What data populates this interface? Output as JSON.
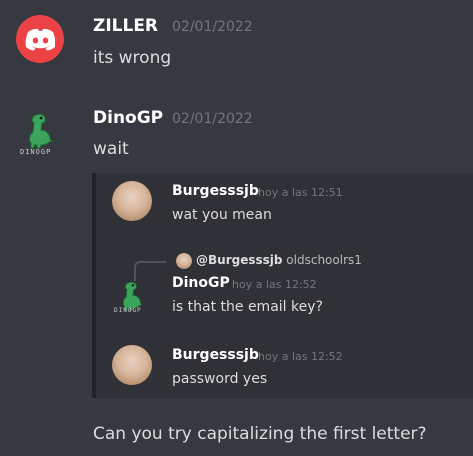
{
  "messages": [
    {
      "author": "ZILLER",
      "timestamp": "02/01/2022",
      "text": "its wrong",
      "avatar_icon": "discord-logo-icon",
      "avatar_color": "#ed4245"
    },
    {
      "author": "DinoGP",
      "timestamp": "02/01/2022",
      "text": "wait",
      "avatar_icon": "dino-avatar-icon",
      "avatar_caption": "DINOGP"
    },
    {
      "author": "",
      "timestamp": "",
      "text": "Can you try capitalizing the first letter?"
    }
  ],
  "embed": {
    "messages": [
      {
        "author": "Burgesssjb",
        "timestamp": "hoy a las 12:51",
        "text": "wat you mean",
        "avatar_icon": "user-photo-avatar"
      },
      {
        "reply": {
          "mention": "@Burgesssjb",
          "snippet": "oldschoolrs1"
        },
        "author": "DinoGP",
        "timestamp": "hoy a las 12:52",
        "text": "is that the email key?",
        "avatar_icon": "dino-avatar-icon",
        "avatar_caption": "DINOGP"
      },
      {
        "author": "Burgesssjb",
        "timestamp": "hoy a las 12:52",
        "text": "password yes",
        "avatar_icon": "user-photo-avatar"
      }
    ]
  },
  "colors": {
    "background": "#36393f",
    "text": "#dcddde",
    "muted": "#72767d",
    "username": "#ffffff",
    "embed_bg": "#2f3136",
    "dino_green": "#3ba55c"
  }
}
